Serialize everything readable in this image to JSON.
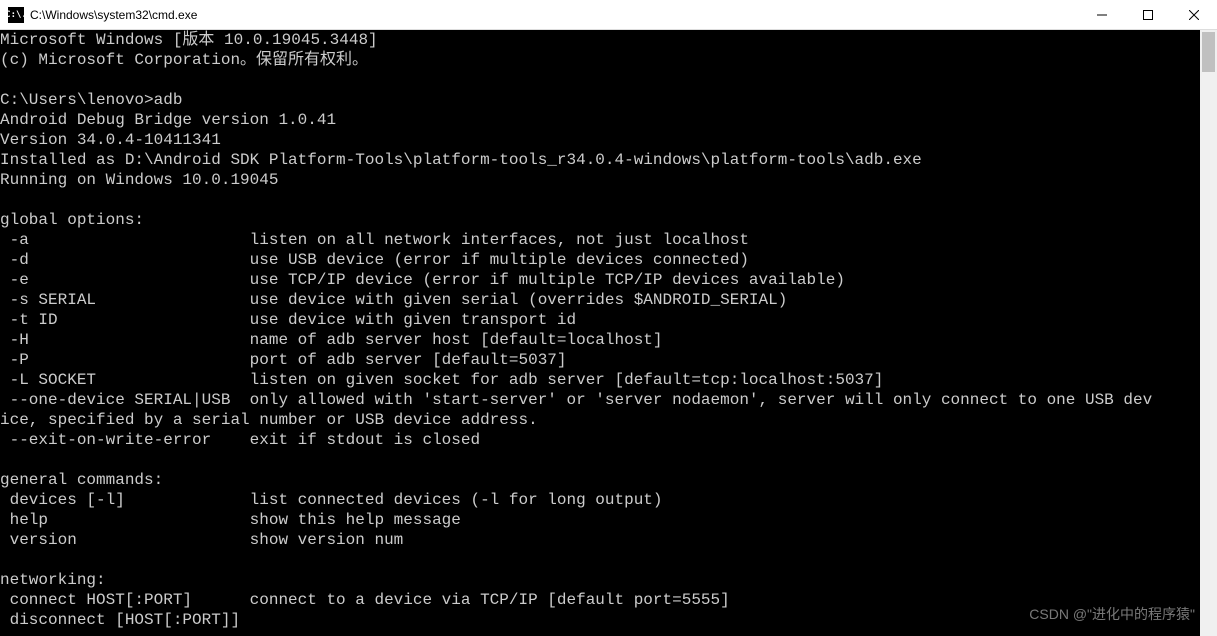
{
  "window": {
    "icon_label": "C:\\.",
    "title": "C:\\Windows\\system32\\cmd.exe"
  },
  "terminal": {
    "lines": [
      "Microsoft Windows [版本 10.0.19045.3448]",
      "(c) Microsoft Corporation。保留所有权利。",
      "",
      "C:\\Users\\lenovo>adb",
      "Android Debug Bridge version 1.0.41",
      "Version 34.0.4-10411341",
      "Installed as D:\\Android SDK Platform-Tools\\platform-tools_r34.0.4-windows\\platform-tools\\adb.exe",
      "Running on Windows 10.0.19045",
      "",
      "global options:",
      " -a                       listen on all network interfaces, not just localhost",
      " -d                       use USB device (error if multiple devices connected)",
      " -e                       use TCP/IP device (error if multiple TCP/IP devices available)",
      " -s SERIAL                use device with given serial (overrides $ANDROID_SERIAL)",
      " -t ID                    use device with given transport id",
      " -H                       name of adb server host [default=localhost]",
      " -P                       port of adb server [default=5037]",
      " -L SOCKET                listen on given socket for adb server [default=tcp:localhost:5037]",
      " --one-device SERIAL|USB  only allowed with 'start-server' or 'server nodaemon', server will only connect to one USB dev",
      "ice, specified by a serial number or USB device address.",
      " --exit-on-write-error    exit if stdout is closed",
      "",
      "general commands:",
      " devices [-l]             list connected devices (-l for long output)",
      " help                     show this help message",
      " version                  show version num",
      "",
      "networking:",
      " connect HOST[:PORT]      connect to a device via TCP/IP [default port=5555]",
      " disconnect [HOST[:PORT]]"
    ]
  },
  "watermark": "CSDN @\"进化中的程序猿\""
}
